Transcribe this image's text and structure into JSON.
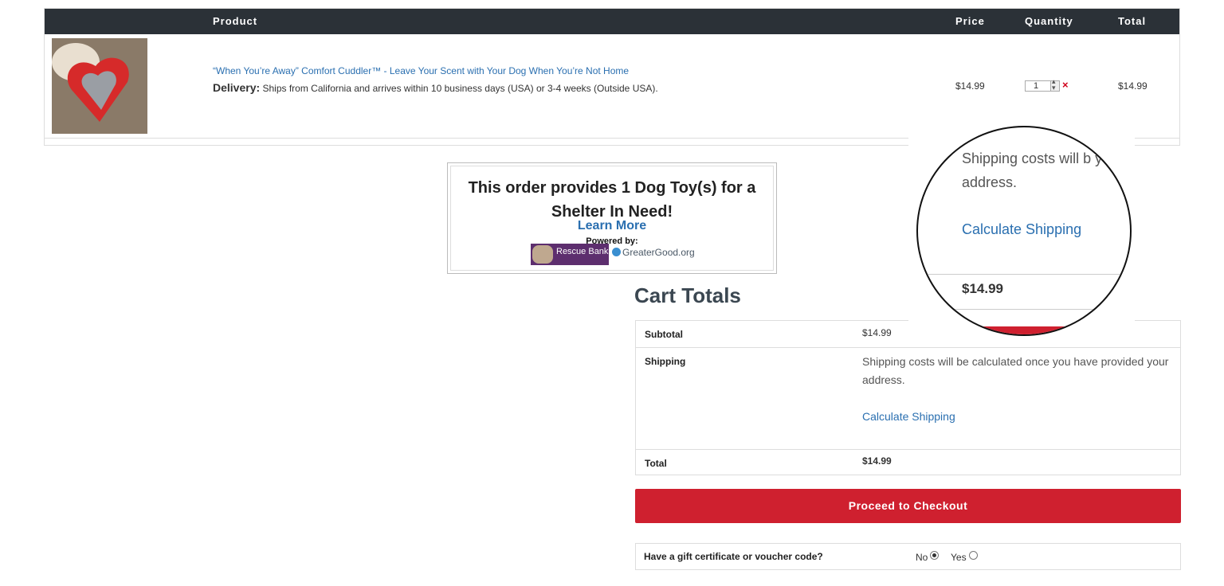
{
  "cart": {
    "headers": {
      "product": "Product",
      "price": "Price",
      "quantity": "Quantity",
      "total": "Total"
    },
    "item": {
      "name": "“When You’re Away” Comfort Cuddler™ - Leave Your Scent with Your Dog When You’re Not Home",
      "delivery_label": "Delivery:",
      "delivery_text": "Ships from California and arrives within 10 business days (USA) or 3-4 weeks (Outside USA).",
      "price": "$14.99",
      "quantity": "1",
      "total": "$14.99",
      "remove_icon": "×"
    }
  },
  "shelter": {
    "title": "This order provides 1 Dog Toy(s) for a Shelter In Need!",
    "learn_more": "Learn More",
    "powered_by": "Powered by:",
    "logo_rescue_bank": "Rescue Bank",
    "logo_greatergood": "GreaterGood.org"
  },
  "totals": {
    "heading": "Cart Totals",
    "subtotal_label": "Subtotal",
    "subtotal_value": "$14.99",
    "shipping_label": "Shipping",
    "shipping_text": "Shipping costs will be calculated once you have provided your address.",
    "calculate_shipping": "Calculate Shipping",
    "total_label": "Total",
    "total_value": "$14.99"
  },
  "checkout": {
    "label": "Proceed to Checkout"
  },
  "gift": {
    "question": "Have a gift certificate or voucher code?",
    "no": "No",
    "yes": "Yes",
    "selected": "No"
  },
  "magnifier": {
    "text": "Shipping costs will b your address.",
    "link": "Calculate Shipping",
    "total": "$14.99"
  },
  "colors": {
    "header_bg": "#2b3137",
    "link": "#2a6fb0",
    "checkout": "#cf202f",
    "remove": "#d0021b"
  }
}
